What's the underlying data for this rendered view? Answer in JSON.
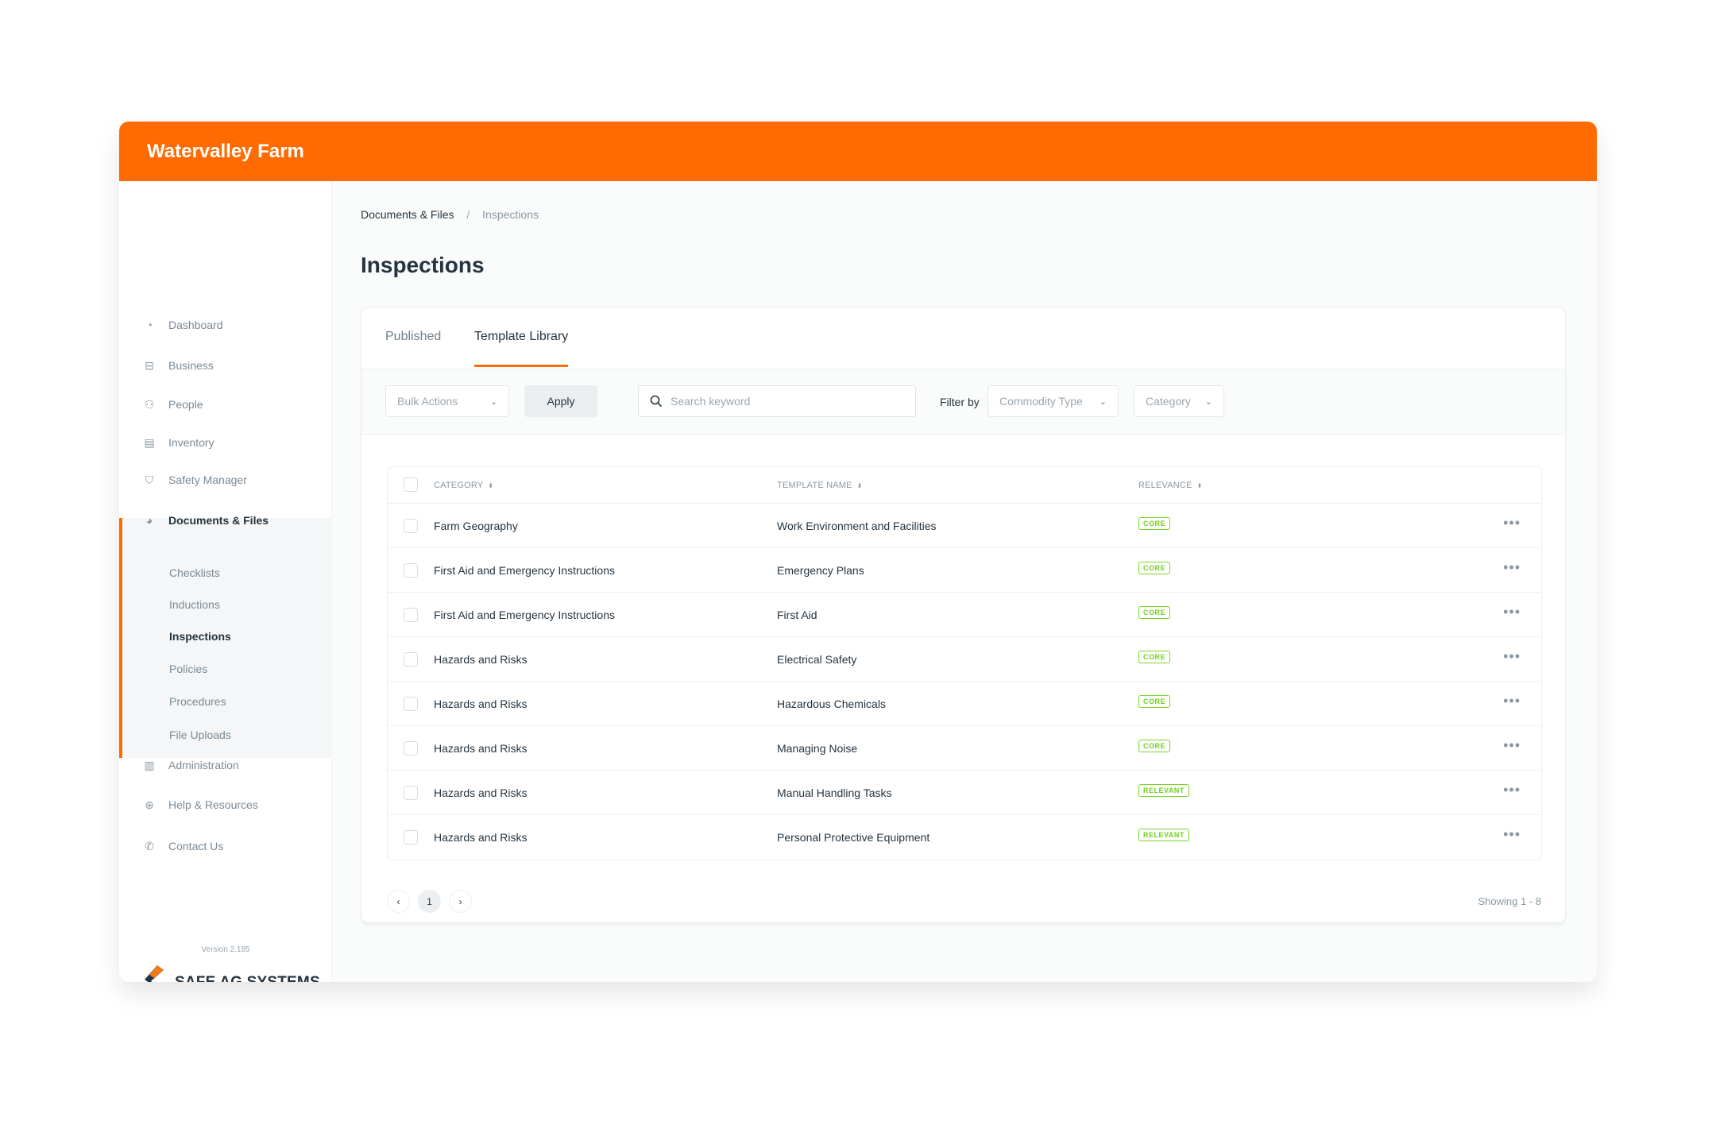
{
  "app": {
    "title": "Watervalley Farm",
    "brand_color": "#ff6b00"
  },
  "sidebar": {
    "items": [
      {
        "label": "Dashboard",
        "icon": "gauge-icon"
      },
      {
        "label": "Business",
        "icon": "briefcase-icon"
      },
      {
        "label": "People",
        "icon": "users-icon"
      },
      {
        "label": "Inventory",
        "icon": "clipboard-icon"
      },
      {
        "label": "Safety Manager",
        "icon": "shield-icon"
      },
      {
        "label": "Documents & Files",
        "icon": "pie-chart-icon",
        "active": true
      },
      {
        "label": "Administration",
        "icon": "bar-chart-icon"
      },
      {
        "label": "Help & Resources",
        "icon": "lifebuoy-icon"
      },
      {
        "label": "Contact Us",
        "icon": "phone-icon"
      }
    ],
    "subitems": [
      {
        "label": "Checklists"
      },
      {
        "label": "Inductions"
      },
      {
        "label": "Inspections",
        "active": true
      },
      {
        "label": "Policies"
      },
      {
        "label": "Procedures"
      },
      {
        "label": "File Uploads"
      }
    ],
    "logo_text": "SAFE AG SYSTEMS",
    "version": "Version 2.185"
  },
  "breadcrumb": {
    "parent": "Documents & Files",
    "separator": "/",
    "current": "Inspections"
  },
  "page_title": "Inspections",
  "tabs": [
    {
      "label": "Published"
    },
    {
      "label": "Template Library",
      "active": true
    }
  ],
  "toolbar": {
    "bulk_actions": "Bulk Actions",
    "apply": "Apply",
    "search_placeholder": "Search keyword",
    "filter_label": "Filter by",
    "commodity_type": "Commodity Type",
    "category": "Category"
  },
  "table": {
    "columns": [
      "CATEGORY",
      "TEMPLATE NAME",
      "RELEVANCE"
    ],
    "rows": [
      {
        "category": "Farm Geography",
        "template": "Work Environment and Facilities",
        "relevance": "CORE"
      },
      {
        "category": "First Aid and Emergency Instructions",
        "template": "Emergency Plans",
        "relevance": "CORE"
      },
      {
        "category": "First Aid and Emergency Instructions",
        "template": "First Aid",
        "relevance": "CORE"
      },
      {
        "category": "Hazards and Risks",
        "template": "Electrical Safety",
        "relevance": "CORE"
      },
      {
        "category": "Hazards and Risks",
        "template": "Hazardous Chemicals",
        "relevance": "CORE"
      },
      {
        "category": "Hazards and Risks",
        "template": "Managing Noise",
        "relevance": "CORE"
      },
      {
        "category": "Hazards and Risks",
        "template": "Manual Handling Tasks",
        "relevance": "RELEVANT"
      },
      {
        "category": "Hazards and Risks",
        "template": "Personal Protective Equipment",
        "relevance": "RELEVANT"
      }
    ]
  },
  "pagination": {
    "prev": "‹",
    "current": "1",
    "next": "›",
    "showing": "Showing 1 - 8"
  }
}
